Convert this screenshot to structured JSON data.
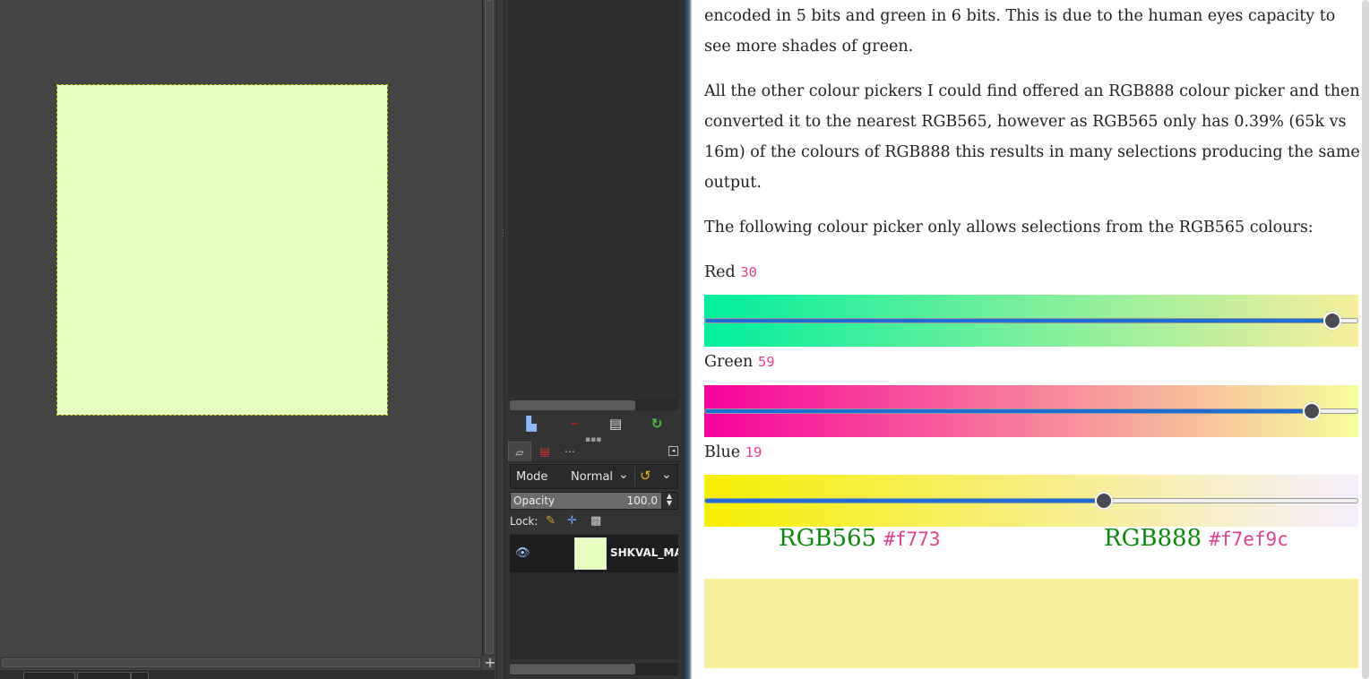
{
  "gimp": {
    "image_color": "#e6ffbe",
    "nav_glyph": "+"
  },
  "dock": {
    "mode_label": "Mode",
    "mode_value": "Normal",
    "opacity_label": "Opacity",
    "opacity_value": "100.0",
    "opacity_fraction": 1.0,
    "lock_label": "Lock:",
    "layer_name": "SHKVAL_MA"
  },
  "article": {
    "paragraph1": "encoded in 5 bits and green in 6 bits. This is due to the human eyes capacity to see more shades of green.",
    "paragraph2": "All the other colour pickers I could find offered an RGB888 colour picker and then converted it to the nearest RGB565, however as RGB565 only has 0.39% (65k vs 16m) of the colours of RGB888 this results in many selections producing the same output.",
    "paragraph3": "The following colour picker only allows selections from the RGB565 colours:",
    "sliders": [
      {
        "label": "Red",
        "value": "30",
        "max": 31,
        "gradient_from": "#00ef9c",
        "gradient_to": "#f7ef9c"
      },
      {
        "label": "Green",
        "value": "59",
        "max": 63,
        "gradient_from": "#f7009c",
        "gradient_to": "#f7ff9c"
      },
      {
        "label": "Blue",
        "value": "19",
        "max": 31,
        "gradient_from": "#f7ef00",
        "gradient_to": "#f7efff"
      }
    ],
    "rgb565_label": "RGB565",
    "rgb565_value": "#f773",
    "rgb888_label": "RGB888",
    "rgb888_value": "#f7ef9c",
    "preview_color": "#f7ef9c"
  }
}
